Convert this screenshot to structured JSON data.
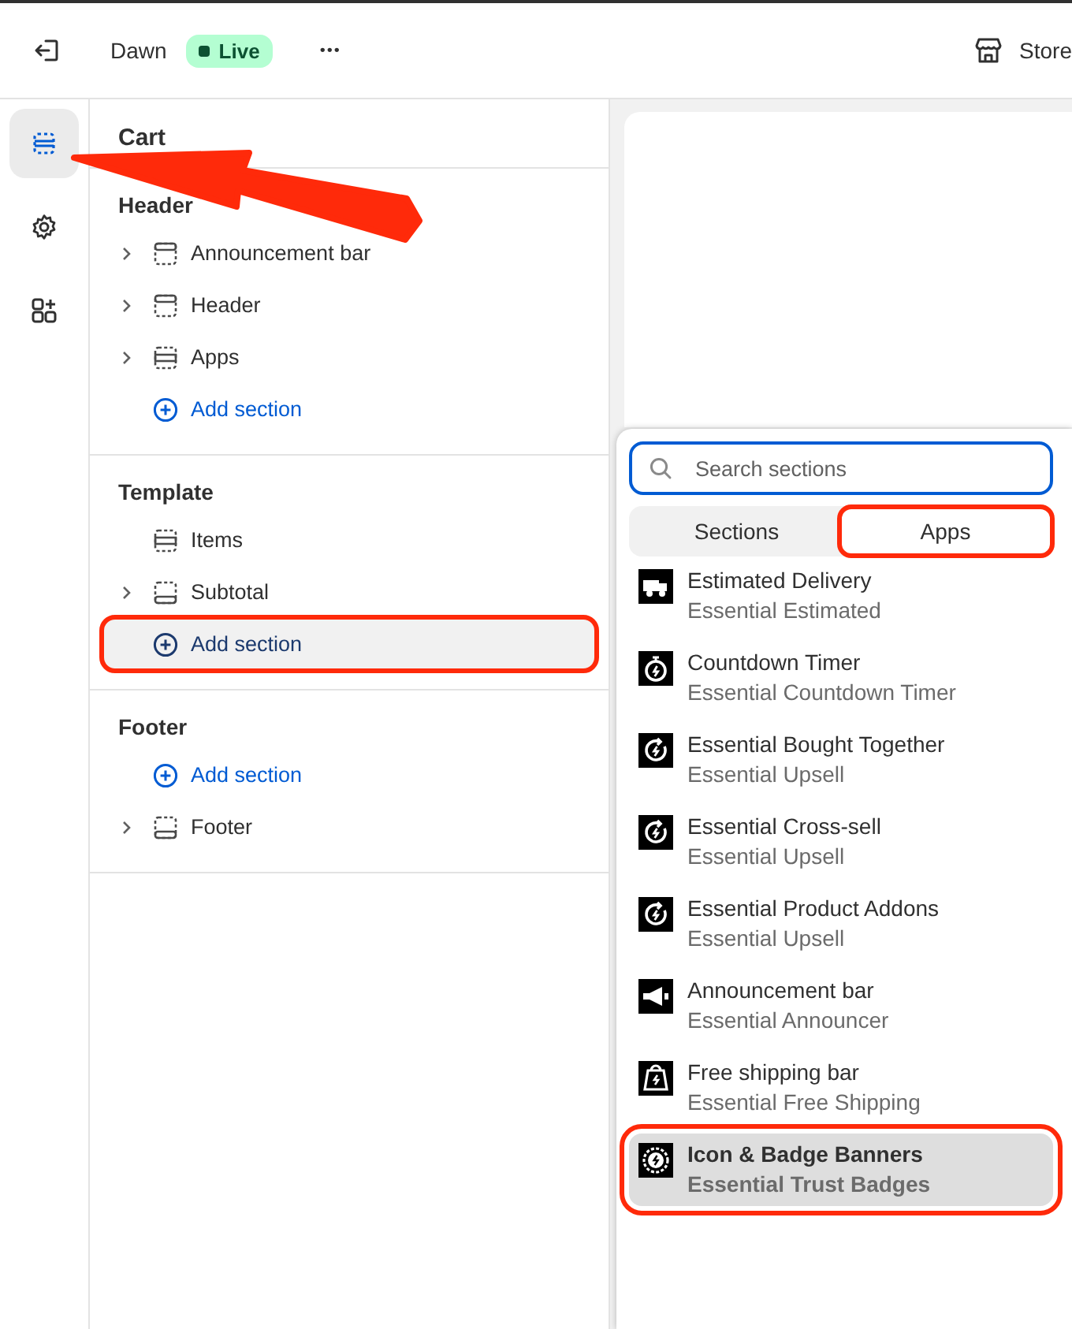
{
  "topbar": {
    "theme": "Dawn",
    "status": "Live",
    "more": "•••",
    "store": "Store"
  },
  "rail": [
    {
      "kind": "sections",
      "selected": true
    },
    {
      "kind": "settings",
      "selected": false
    },
    {
      "kind": "apps",
      "selected": false
    }
  ],
  "arrow": true,
  "panel": {
    "title": "Cart",
    "groups": [
      {
        "title": "Header",
        "items": [
          {
            "kind": "topband",
            "label": "Announcement bar",
            "expandable": true
          },
          {
            "kind": "topband",
            "label": "Header",
            "expandable": true
          },
          {
            "kind": "midband",
            "label": "Apps",
            "expandable": true
          },
          {
            "kind": "add",
            "label": "Add section",
            "highlighted": false,
            "annotated": false
          }
        ]
      },
      {
        "title": "Template",
        "items": [
          {
            "kind": "midband",
            "label": "Items",
            "expandable": false
          },
          {
            "kind": "lowband",
            "label": "Subtotal",
            "expandable": true
          },
          {
            "kind": "add",
            "label": "Add section",
            "highlighted": true,
            "annotated": true
          }
        ]
      },
      {
        "title": "Footer",
        "items": [
          {
            "kind": "add",
            "label": "Add section",
            "highlighted": false,
            "annotated": false
          },
          {
            "kind": "lowband",
            "label": "Footer",
            "expandable": true
          }
        ]
      }
    ]
  },
  "picker": {
    "search": {
      "placeholder": "Search sections"
    },
    "tabs": [
      {
        "label": "Sections",
        "selected": false,
        "annotated": false
      },
      {
        "label": "Apps",
        "selected": true,
        "annotated": true
      }
    ],
    "apps": [
      {
        "kind": "truck",
        "title": "Estimated Delivery",
        "subtitle": "Essential Estimated",
        "selected": false,
        "annotated": false
      },
      {
        "kind": "timer",
        "title": "Countdown Timer",
        "subtitle": "Essential Countdown Timer",
        "selected": false,
        "annotated": false
      },
      {
        "kind": "upsell",
        "title": "Essential Bought Together",
        "subtitle": "Essential Upsell",
        "selected": false,
        "annotated": false
      },
      {
        "kind": "upsell",
        "title": "Essential Cross-sell",
        "subtitle": "Essential Upsell",
        "selected": false,
        "annotated": false
      },
      {
        "kind": "upsell",
        "title": "Essential Product Addons",
        "subtitle": "Essential Upsell",
        "selected": false,
        "annotated": false
      },
      {
        "kind": "megaphone",
        "title": "Announcement bar",
        "subtitle": "Essential Announcer",
        "selected": false,
        "annotated": false
      },
      {
        "kind": "bag",
        "title": "Free shipping bar",
        "subtitle": "Essential Free Shipping",
        "selected": false,
        "annotated": false
      },
      {
        "kind": "badge",
        "title": "Icon & Badge Banners",
        "subtitle": "Essential Trust Badges",
        "selected": true,
        "annotated": true
      }
    ]
  }
}
